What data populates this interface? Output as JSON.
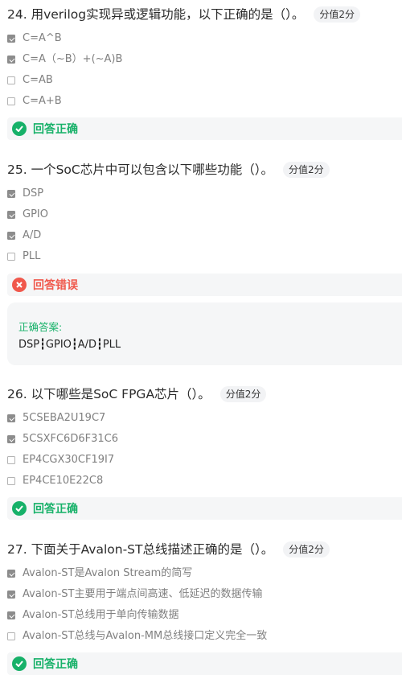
{
  "questions": [
    {
      "number": "24.",
      "text": "用verilog实现异或逻辑功能，以下正确的是（）。",
      "score": "分值2分",
      "options": [
        {
          "label": "C=A^B",
          "checked": true
        },
        {
          "label": "C=A（~B）+(~A)B",
          "checked": true
        },
        {
          "label": "C=AB",
          "checked": false
        },
        {
          "label": "C=A+B",
          "checked": false
        }
      ],
      "result": {
        "status": "correct",
        "text": "回答正确"
      }
    },
    {
      "number": "25.",
      "text": "一个SoC芯片中可以包含以下哪些功能（）。",
      "score": "分值2分",
      "options": [
        {
          "label": "DSP",
          "checked": true
        },
        {
          "label": "GPIO",
          "checked": true
        },
        {
          "label": "A/D",
          "checked": true
        },
        {
          "label": "PLL",
          "checked": false
        }
      ],
      "result": {
        "status": "wrong",
        "text": "回答错误"
      },
      "correct_answer": {
        "label": "正确答案:",
        "value": "DSP┇GPIO┇A/D┇PLL"
      }
    },
    {
      "number": "26.",
      "text": "以下哪些是SoC FPGA芯片（）。",
      "score": "分值2分",
      "options": [
        {
          "label": "5CSEBA2U19C7",
          "checked": true
        },
        {
          "label": "5CSXFC6D6F31C6",
          "checked": true
        },
        {
          "label": "EP4CGX30CF19I7",
          "checked": false
        },
        {
          "label": "EP4CE10E22C8",
          "checked": false
        }
      ],
      "result": {
        "status": "correct",
        "text": "回答正确"
      }
    },
    {
      "number": "27.",
      "text": "下面关于Avalon-ST总线描述正确的是（）。",
      "score": "分值2分",
      "options": [
        {
          "label": "Avalon-ST是Avalon Stream的简写",
          "checked": true
        },
        {
          "label": "Avalon-ST主要用于端点间高速、低延迟的数据传输",
          "checked": true
        },
        {
          "label": "Avalon-ST总线用于单向传输数据",
          "checked": true
        },
        {
          "label": "Avalon-ST总线与Avalon-MM总线接口定义完全一致",
          "checked": false
        }
      ],
      "result": {
        "status": "correct",
        "text": "回答正确"
      }
    }
  ],
  "colors": {
    "correct": "#17b169",
    "wrong": "#f0584c",
    "checkbox_checked": "#8c8c8c",
    "result_bg": "#f5f6f7"
  },
  "icons": {
    "correct": "check-circle-icon",
    "wrong": "x-circle-icon",
    "checkbox": "checkbox-icon"
  }
}
